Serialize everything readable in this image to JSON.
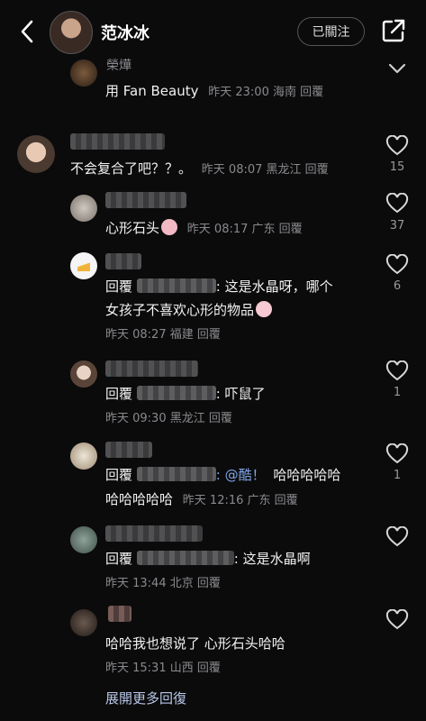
{
  "header": {
    "profile_name": "范冰冰",
    "follow_label": "已關注"
  },
  "comments": [
    {
      "name_partial": "榮燁",
      "text": "用 Fan Beauty",
      "meta": "昨天 23:00 海南 回覆"
    },
    {
      "text": "不会复合了吧？？。",
      "meta": "昨天 08:07 黑龙江 回覆",
      "likes": "15"
    },
    {
      "text": "心形石头",
      "meta": "昨天 08:17 广东 回覆",
      "likes": "37"
    },
    {
      "reply_prefix": "回覆",
      "text_line1": ": 这是水晶呀，哪个",
      "text_line2": "女孩子不喜欢心形的物品",
      "meta": "昨天 08:27 福建 回覆",
      "likes": "6"
    },
    {
      "reply_prefix": "回覆",
      "text": ": 吓鼠了",
      "meta": "昨天 09:30 黑龙江 回覆",
      "likes": "1"
    },
    {
      "reply_prefix": "回覆",
      "text_mention": ": @酷！",
      "text_tail": "哈哈哈哈哈",
      "text_line2": "哈哈哈哈哈",
      "meta": "昨天 12:16 广东 回覆",
      "likes": "1"
    },
    {
      "reply_prefix": "回覆",
      "text": ": 这是水晶啊",
      "meta": "昨天 13:44 北京 回覆"
    },
    {
      "text": "哈哈我也想说了 心形石头哈哈",
      "meta": "昨天 15:31 山西 回覆"
    }
  ],
  "more_replies": "展開更多回復",
  "icons": {
    "back": "chevron-left-icon",
    "share": "share-icon",
    "like": "heart-icon"
  }
}
